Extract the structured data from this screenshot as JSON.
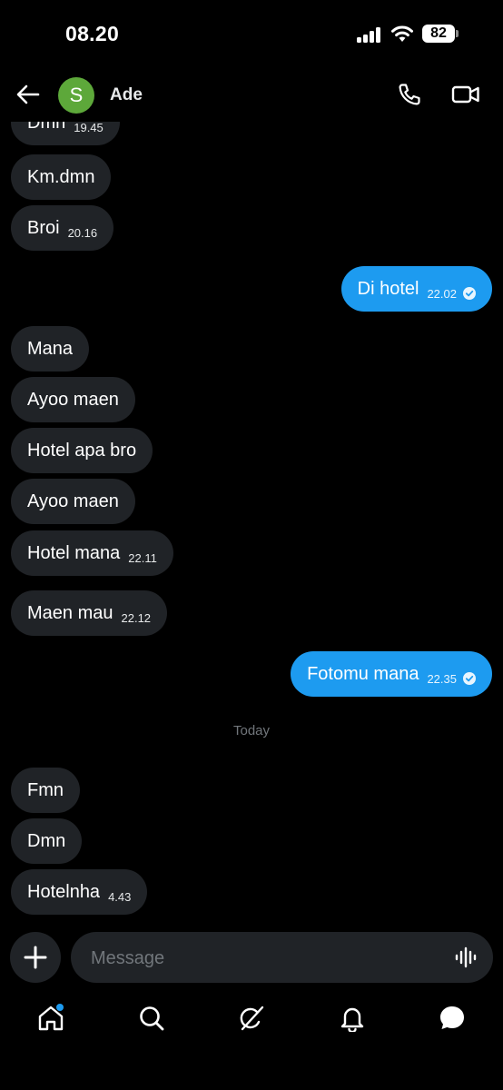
{
  "status_bar": {
    "time": "08.20",
    "battery": "82"
  },
  "header": {
    "avatar_letter": "S",
    "contact_name": "Ade"
  },
  "messages": [
    {
      "direction": "in",
      "text": "Dmn",
      "time": "19.45"
    },
    {
      "direction": "in",
      "text": "Km.dmn",
      "time": ""
    },
    {
      "direction": "in",
      "text": "Broi",
      "time": "20.16"
    },
    {
      "direction": "out",
      "text": "Di hotel",
      "time": "22.02",
      "read": true
    },
    {
      "direction": "in",
      "text": "Mana",
      "time": ""
    },
    {
      "direction": "in",
      "text": "Ayoo maen",
      "time": ""
    },
    {
      "direction": "in",
      "text": "Hotel apa bro",
      "time": ""
    },
    {
      "direction": "in",
      "text": "Ayoo maen",
      "time": ""
    },
    {
      "direction": "in",
      "text": "Hotel mana",
      "time": "22.11"
    },
    {
      "direction": "in",
      "text": "Maen mau",
      "time": "22.12"
    },
    {
      "direction": "out",
      "text": "Fotomu mana",
      "time": "22.35",
      "read": true
    },
    {
      "direction": "in",
      "text": "Fmn",
      "time": ""
    },
    {
      "direction": "in",
      "text": "Dmn",
      "time": ""
    },
    {
      "direction": "in",
      "text": "Hotelnha",
      "time": "4.43"
    }
  ],
  "day_separator": "Today",
  "composer": {
    "placeholder": "Message"
  },
  "bottom_nav": {
    "items": [
      "home-icon",
      "search-icon",
      "grok-icon",
      "notifications-icon",
      "messages-icon"
    ],
    "home_has_notification": true
  },
  "colors": {
    "accent": "#1d9bf0",
    "incoming_bubble": "#202327",
    "avatar": "#5da83a"
  }
}
